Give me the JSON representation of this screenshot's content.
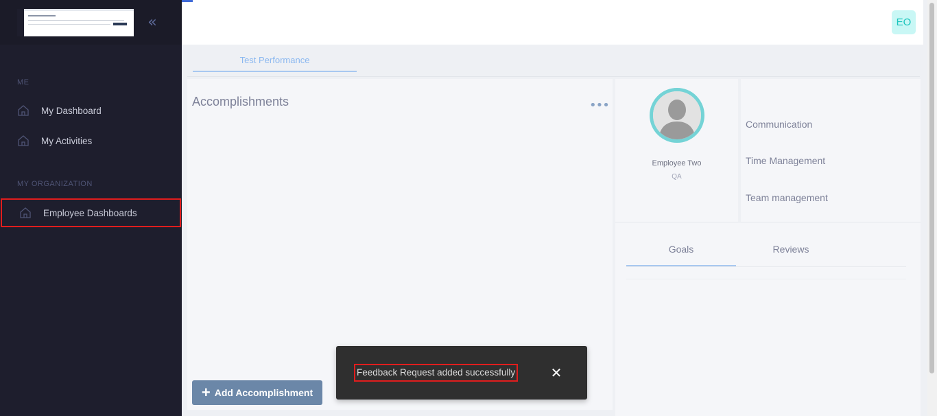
{
  "sidebar": {
    "sections": [
      {
        "label": "ME"
      },
      {
        "label": "MY ORGANIZATION"
      }
    ],
    "items": [
      {
        "label": "My Dashboard",
        "icon": "home-icon"
      },
      {
        "label": "My Activities",
        "icon": "home-icon"
      },
      {
        "label": "Employee Dashboards",
        "icon": "home-icon",
        "active": true
      }
    ]
  },
  "header": {
    "user_initials": "EO"
  },
  "tabs": [
    {
      "label": "Test Performance",
      "active": true
    }
  ],
  "accomplishments": {
    "title": "Accomplishments",
    "add_label": "Add Accomplishment"
  },
  "profile": {
    "name": "Employee Two",
    "role": "QA"
  },
  "skills": [
    "Communication",
    "Time Management",
    "Team management"
  ],
  "goals_reviews": {
    "tabs": [
      {
        "label": "Goals",
        "active": true
      },
      {
        "label": "Reviews",
        "active": false
      }
    ]
  },
  "toast": {
    "message": "Feedback Request added successfully",
    "close_symbol": "✕"
  },
  "colors": {
    "sidebar_bg": "#1e1e2d",
    "accent": "#1bc5bd",
    "highlight": "#e11d1d",
    "button": "#6b87a8"
  }
}
